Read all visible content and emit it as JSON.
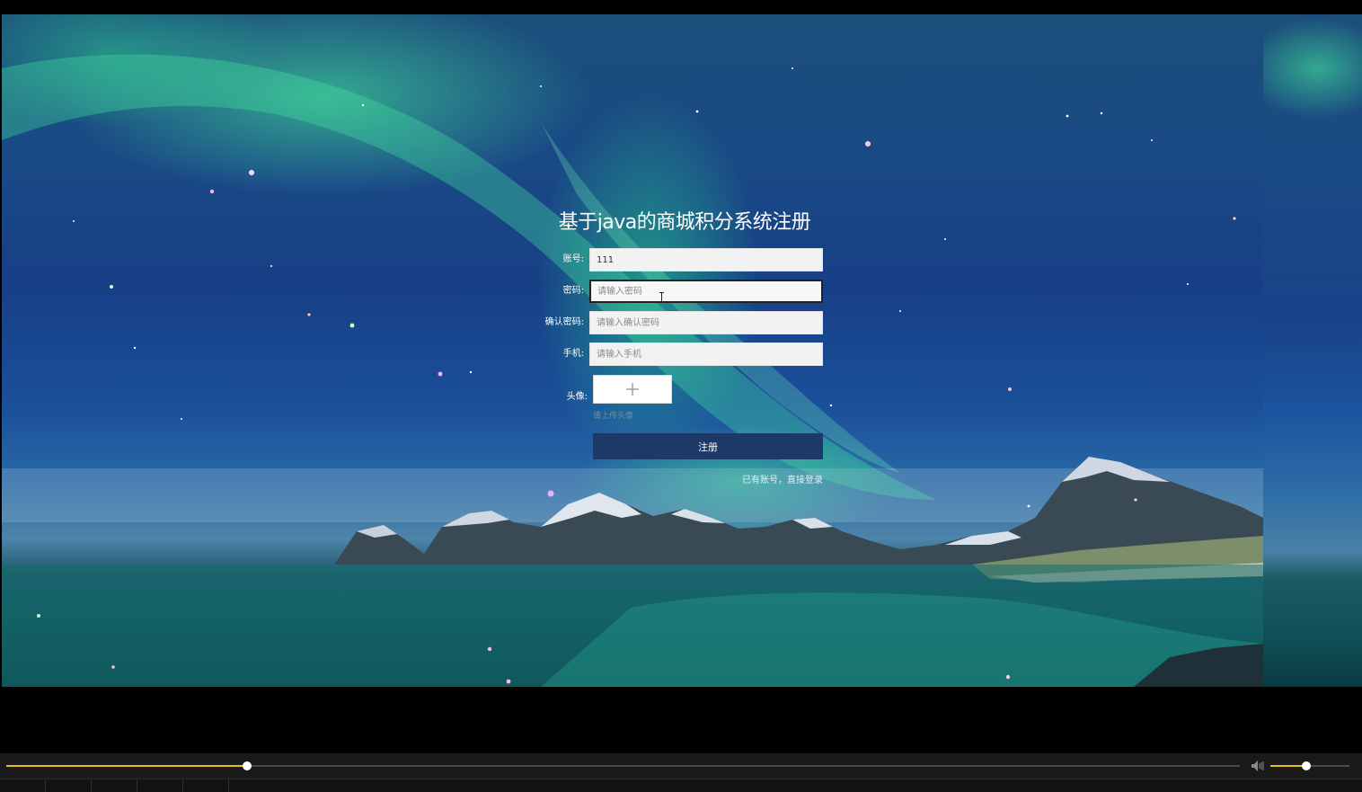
{
  "register": {
    "title": "基于java的商城积分系统注册",
    "account_label": "账号:",
    "account_value": "111",
    "password_label": "密码:",
    "password_placeholder": "请输入密码",
    "confirm_label": "确认密码:",
    "confirm_placeholder": "请输入确认密码",
    "phone_label": "手机:",
    "phone_placeholder": "请输入手机",
    "avatar_label": "头像:",
    "avatar_upload_icon": "plus-icon",
    "avatar_hint": "请上传头像",
    "register_button": "注册",
    "login_link": "已有账号，直接登录"
  },
  "player": {
    "seek_progress": 0.195,
    "volume_level": 0.45,
    "accent_color": "#e5c11c",
    "volume_icon": "speaker-icon"
  }
}
